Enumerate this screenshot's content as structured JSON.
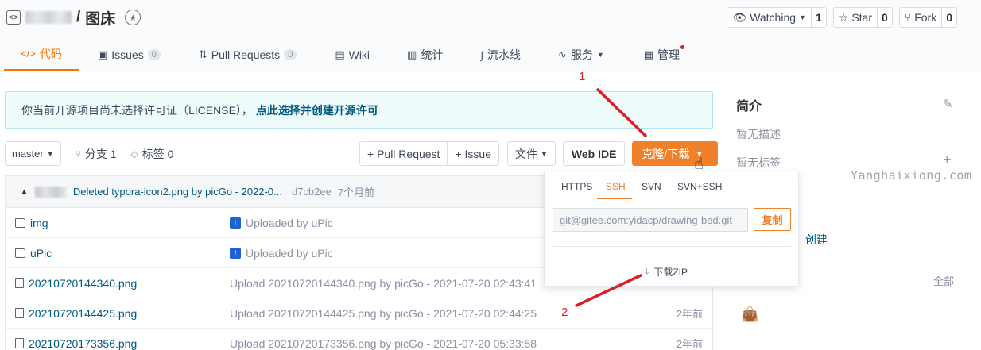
{
  "header": {
    "title_separator": "/",
    "repo_name": "图床",
    "watching": {
      "label": "Watching",
      "count": "1"
    },
    "star": {
      "label": "Star",
      "count": "0"
    },
    "fork": {
      "label": "Fork",
      "count": "0"
    }
  },
  "tabs": [
    {
      "label": "代码",
      "icon": "code-icon"
    },
    {
      "label": "Issues",
      "badge": "0",
      "icon": "issues-icon"
    },
    {
      "label": "Pull Requests",
      "badge": "0",
      "icon": "pull-request-icon"
    },
    {
      "label": "Wiki",
      "icon": "wiki-icon"
    },
    {
      "label": "统计",
      "icon": "stats-icon"
    },
    {
      "label": "流水线",
      "icon": "pipeline-icon"
    },
    {
      "label": "服务",
      "icon": "service-icon"
    },
    {
      "label": "管理",
      "icon": "manage-icon"
    }
  ],
  "notice": {
    "text": "你当前开源项目尚未选择许可证（LICENSE），",
    "link": "点此选择并创建开源许可"
  },
  "toolbar": {
    "branch": "master",
    "branches": "分支 1",
    "tags": "标签 0",
    "pull_request": "+ Pull Request",
    "issue": "+ Issue",
    "file": "文件",
    "web_ide": "Web IDE",
    "clone": "克隆/下载"
  },
  "latest_commit": {
    "message": "Deleted typora-icon2.png by picGo - 2022-0...",
    "sha": "d7cb2ee",
    "time": "7个月前"
  },
  "files": [
    {
      "name": "img",
      "type": "folder",
      "message": "Uploaded by uPic",
      "time": ""
    },
    {
      "name": "uPic",
      "type": "folder",
      "message": "Uploaded by uPic",
      "time": ""
    },
    {
      "name": "20210720144340.png",
      "type": "file",
      "message": "Upload 20210720144340.png by picGo - 2021-07-20 02:43:41",
      "time": ""
    },
    {
      "name": "20210720144425.png",
      "type": "file",
      "message": "Upload 20210720144425.png by picGo - 2021-07-20 02:44:25",
      "time": "2年前"
    },
    {
      "name": "20210720173356.png",
      "type": "file",
      "message": "Upload 20210720173356.png by picGo - 2021-07-20 05:33:58",
      "time": "2年前"
    }
  ],
  "clone_dropdown": {
    "protocols": [
      "HTTPS",
      "SSH",
      "SVN",
      "SVN+SSH"
    ],
    "active_protocol": "SSH",
    "url": "git@gitee.com:yidacp/drawing-bed.git",
    "copy": "复制",
    "download_zip": "下载ZIP"
  },
  "sidebar": {
    "title": "简介",
    "description": "暂无描述",
    "tags": "暂无标签",
    "create": "创建",
    "all": "全部"
  },
  "watermark": "Yanghaixiong.com",
  "annotations": [
    "1",
    "2"
  ],
  "colors": {
    "accent": "#f0802a",
    "link": "#005980",
    "annotation": "#d6202a"
  }
}
